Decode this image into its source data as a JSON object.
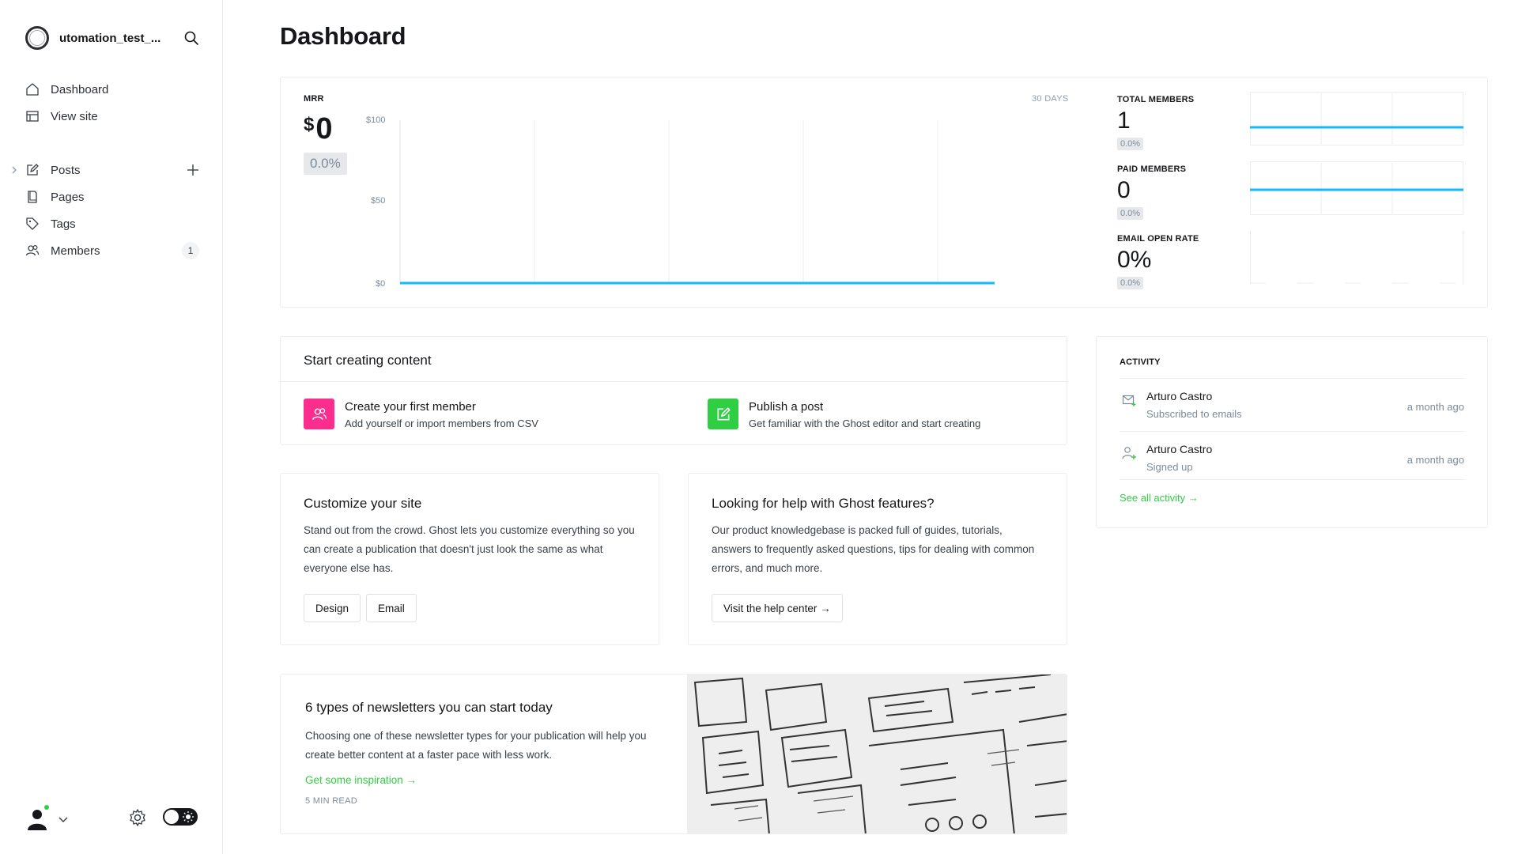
{
  "sidebar": {
    "site_name": "utomation_test_...",
    "items": [
      {
        "label": "Dashboard"
      },
      {
        "label": "View site"
      },
      {
        "label": "Posts"
      },
      {
        "label": "Pages"
      },
      {
        "label": "Tags"
      },
      {
        "label": "Members",
        "count": "1"
      }
    ]
  },
  "page": {
    "title": "Dashboard"
  },
  "mrr": {
    "label": "MRR",
    "currency": "$",
    "value": "0",
    "trend": "0.0%",
    "range": "30 DAYS",
    "y_ticks": [
      "$100",
      "$50",
      "$0"
    ]
  },
  "stats": [
    {
      "label": "TOTAL MEMBERS",
      "value": "1",
      "trend": "0.0%"
    },
    {
      "label": "PAID MEMBERS",
      "value": "0",
      "trend": "0.0%"
    },
    {
      "label": "EMAIL OPEN RATE",
      "value": "0%",
      "trend": "0.0%"
    }
  ],
  "start": {
    "title": "Start creating content",
    "actions": [
      {
        "title": "Create your first member",
        "desc": "Add yourself or import members from CSV",
        "color": "#fb2d8d"
      },
      {
        "title": "Publish a post",
        "desc": "Get familiar with the Ghost editor and start creating",
        "color": "#30cf43"
      }
    ]
  },
  "activity": {
    "label": "ACTIVITY",
    "items": [
      {
        "name": "Arturo Castro",
        "desc": "Subscribed to emails",
        "time": "a month ago",
        "icon": "mail-icon"
      },
      {
        "name": "Arturo Castro",
        "desc": "Signed up",
        "time": "a month ago",
        "icon": "user-add-icon"
      }
    ],
    "see_all": "See all activity →"
  },
  "customize": {
    "title": "Customize your site",
    "body": "Stand out from the crowd. Ghost lets you customize everything so you can create a publication that doesn't just look the same as what everyone else has.",
    "buttons": [
      "Design",
      "Email"
    ]
  },
  "help": {
    "title": "Looking for help with Ghost features?",
    "body": "Our product knowledgebase is packed full of guides, tutorials, answers to frequently asked questions, tips for dealing with common errors, and much more.",
    "button": "Visit the help center →"
  },
  "newsletter": {
    "title": "6 types of newsletters you can start today",
    "body": "Choosing one of these newsletter types for your publication will help you create better content at a faster pace with less work.",
    "link": "Get some inspiration →",
    "read_time": "5 MIN READ"
  },
  "colors": {
    "accent": "#30cf43",
    "chart_line": "#14b8ff",
    "pink": "#fb2d8d"
  }
}
